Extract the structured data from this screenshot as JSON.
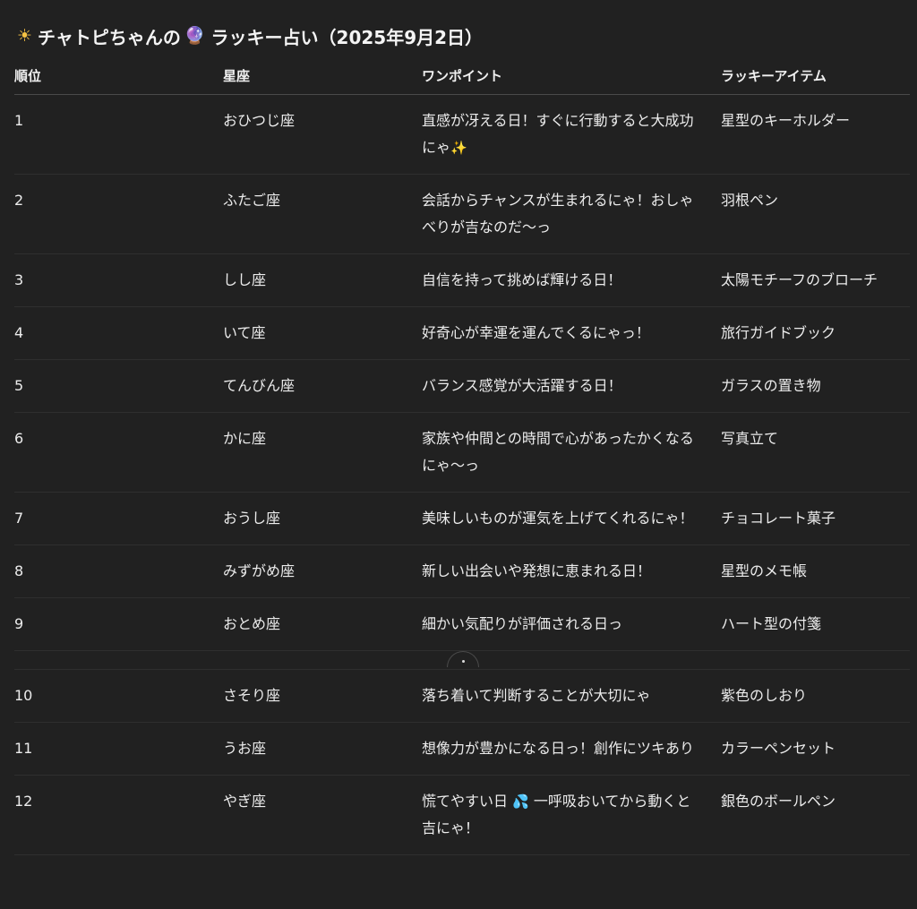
{
  "title": {
    "sun_icon": "sun-emoji",
    "part1": "チャトピちゃんの",
    "ball_icon": "crystal-ball-emoji",
    "part2": "ラッキー占い（2025年9月2日）"
  },
  "table": {
    "headers": [
      "順位",
      "星座",
      "ワンポイント",
      "ラッキーアイテム"
    ],
    "rows": [
      {
        "rank": "1",
        "sign": "おひつじ座",
        "tip": "直感が冴える日！すぐに行動すると大成功にゃ",
        "tip_emoji": "✨",
        "item": "星型のキーホルダー"
      },
      {
        "rank": "2",
        "sign": "ふたご座",
        "tip": "会話からチャンスが生まれるにゃ！おしゃべりが吉なのだ〜っ",
        "item": "羽根ペン"
      },
      {
        "rank": "3",
        "sign": "しし座",
        "tip": "自信を持って挑めば輝ける日！",
        "item": "太陽モチーフのブローチ"
      },
      {
        "rank": "4",
        "sign": "いて座",
        "tip": "好奇心が幸運を運んでくるにゃっ！",
        "item": "旅行ガイドブック"
      },
      {
        "rank": "5",
        "sign": "てんびん座",
        "tip": "バランス感覚が大活躍する日！",
        "item": "ガラスの置き物"
      },
      {
        "rank": "6",
        "sign": "かに座",
        "tip": "家族や仲間との時間で心があったかくなるにゃ〜っ",
        "item": "写真立て"
      },
      {
        "rank": "7",
        "sign": "おうし座",
        "tip": "美味しいものが運気を上げてくれるにゃ！",
        "item": "チョコレート菓子"
      },
      {
        "rank": "8",
        "sign": "みずがめ座",
        "tip": "新しい出会いや発想に恵まれる日！",
        "item": "星型のメモ帳"
      },
      {
        "rank": "9",
        "sign": "おとめ座",
        "tip": "細かい気配りが評価される日っ",
        "item": "ハート型の付箋"
      },
      {
        "rank": "10",
        "sign": "さそり座",
        "tip": "落ち着いて判断することが大切にゃ",
        "item": "紫色のしおり"
      },
      {
        "rank": "11",
        "sign": "うお座",
        "tip": "想像力が豊かになる日っ！創作にツキあり",
        "item": "カラーペンセット"
      },
      {
        "rank": "12",
        "sign": "やぎ座",
        "tip_pre": "慌てやすい日",
        "tip_emoji": "💦",
        "tip_post": "一呼吸おいてから動くと吉にゃ！",
        "item": "銀色のボールペン"
      }
    ]
  }
}
